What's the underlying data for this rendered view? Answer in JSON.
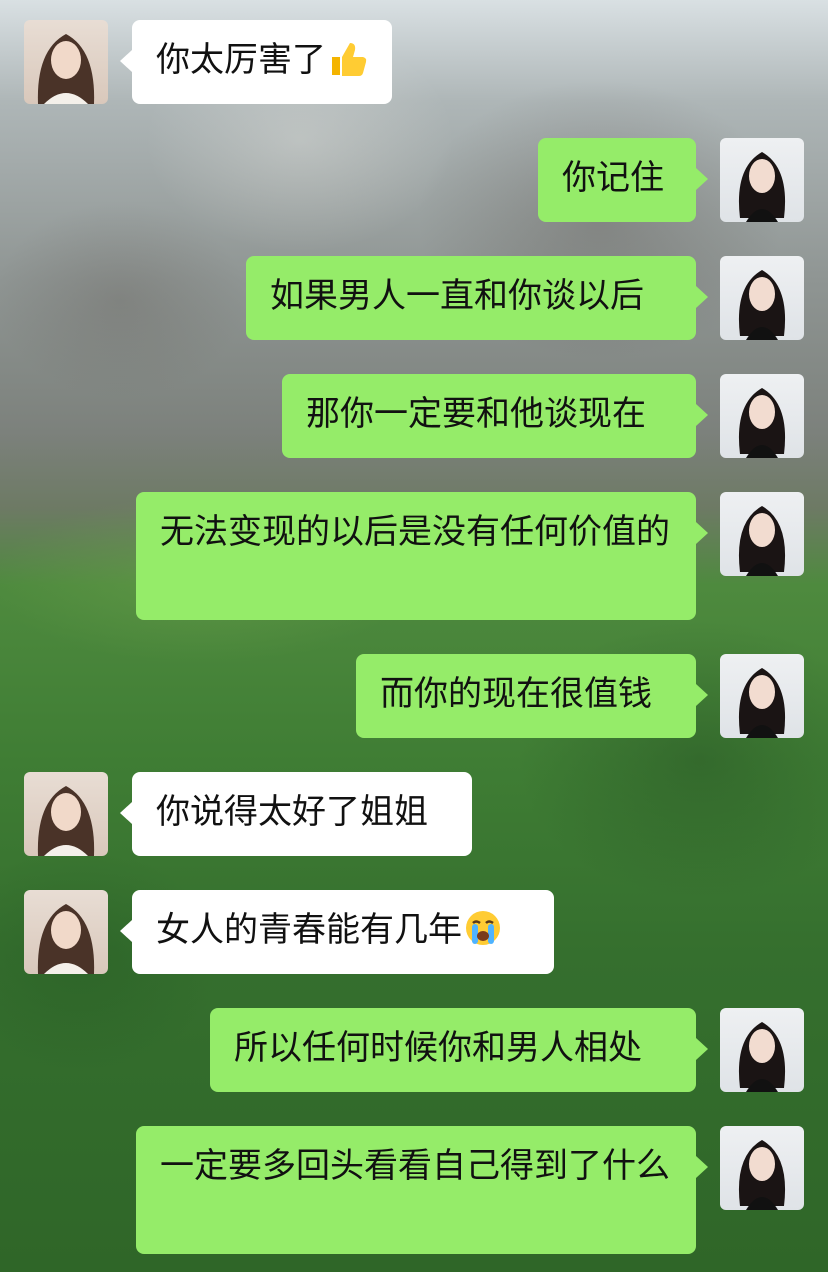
{
  "chat": {
    "messages": [
      {
        "from": "friend",
        "text": "你太厉害了",
        "emoji": "thumbs-up-emoji"
      },
      {
        "from": "sister",
        "text": "你记住"
      },
      {
        "from": "sister",
        "text": "如果男人一直和你谈以后"
      },
      {
        "from": "sister",
        "text": "那你一定要和他谈现在"
      },
      {
        "from": "sister",
        "text": "无法变现的以后是没有任何价值的"
      },
      {
        "from": "sister",
        "text": "而你的现在很值钱"
      },
      {
        "from": "friend",
        "text": "你说得太好了姐姐"
      },
      {
        "from": "friend",
        "text": "女人的青春能有几年",
        "emoji": "loudly-crying-emoji"
      },
      {
        "from": "sister",
        "text": "所以任何时候你和男人相处"
      },
      {
        "from": "sister",
        "text": "一定要多回头看看自己得到了什么"
      }
    ]
  },
  "colors": {
    "outgoing_bubble": "#95ec69",
    "incoming_bubble": "#ffffff",
    "text": "#111111"
  }
}
